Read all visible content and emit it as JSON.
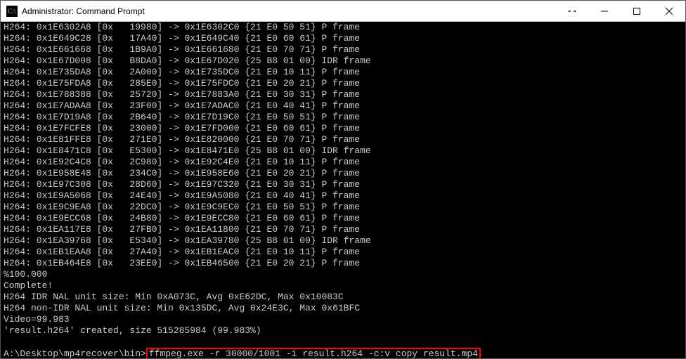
{
  "window": {
    "title": "Administrator: Command Prompt",
    "icon_name": "cmd-icon"
  },
  "rows": [
    {
      "tag": "H264:",
      "a": "0x1E6302A8",
      "b": "[0x",
      "c": "19980]",
      "d": "0x1E6302C0",
      "f": "{21 E0 50 51}",
      "t": "P frame"
    },
    {
      "tag": "H264:",
      "a": "0x1E649C28",
      "b": "[0x",
      "c": "17A40]",
      "d": "0x1E649C40",
      "f": "{21 E0 60 61}",
      "t": "P frame"
    },
    {
      "tag": "H264:",
      "a": "0x1E661668",
      "b": "[0x",
      "c": "1B9A0]",
      "d": "0x1E661680",
      "f": "{21 E0 70 71}",
      "t": "P frame"
    },
    {
      "tag": "H264:",
      "a": "0x1E67D008",
      "b": "[0x",
      "c": "B8DA0]",
      "d": "0x1E67D020",
      "f": "{25 B8 01 00}",
      "t": "IDR frame"
    },
    {
      "tag": "H264:",
      "a": "0x1E735DA8",
      "b": "[0x",
      "c": "2A000]",
      "d": "0x1E735DC0",
      "f": "{21 E0 10 11}",
      "t": "P frame"
    },
    {
      "tag": "H264:",
      "a": "0x1E75FDA8",
      "b": "[0x",
      "c": "285E0]",
      "d": "0x1E75FDC0",
      "f": "{21 E0 20 21}",
      "t": "P frame"
    },
    {
      "tag": "H264:",
      "a": "0x1E788388",
      "b": "[0x",
      "c": "25720]",
      "d": "0x1E7883A0",
      "f": "{21 E0 30 31}",
      "t": "P frame"
    },
    {
      "tag": "H264:",
      "a": "0x1E7ADAA8",
      "b": "[0x",
      "c": "23F00]",
      "d": "0x1E7ADAC0",
      "f": "{21 E0 40 41}",
      "t": "P frame"
    },
    {
      "tag": "H264:",
      "a": "0x1E7D19A8",
      "b": "[0x",
      "c": "2B640]",
      "d": "0x1E7D19C0",
      "f": "{21 E0 50 51}",
      "t": "P frame"
    },
    {
      "tag": "H264:",
      "a": "0x1E7FCFE8",
      "b": "[0x",
      "c": "23000]",
      "d": "0x1E7FD000",
      "f": "{21 E0 60 61}",
      "t": "P frame"
    },
    {
      "tag": "H264:",
      "a": "0x1E81FFE8",
      "b": "[0x",
      "c": "271E0]",
      "d": "0x1E820000",
      "f": "{21 E0 70 71}",
      "t": "P frame"
    },
    {
      "tag": "H264:",
      "a": "0x1E8471C8",
      "b": "[0x",
      "c": "E5300]",
      "d": "0x1E8471E0",
      "f": "{25 B8 01 00}",
      "t": "IDR frame"
    },
    {
      "tag": "H264:",
      "a": "0x1E92C4C8",
      "b": "[0x",
      "c": "2C980]",
      "d": "0x1E92C4E0",
      "f": "{21 E0 10 11}",
      "t": "P frame"
    },
    {
      "tag": "H264:",
      "a": "0x1E958E48",
      "b": "[0x",
      "c": "234C0]",
      "d": "0x1E958E60",
      "f": "{21 E0 20 21}",
      "t": "P frame"
    },
    {
      "tag": "H264:",
      "a": "0x1E97C308",
      "b": "[0x",
      "c": "28D60]",
      "d": "0x1E97C320",
      "f": "{21 E0 30 31}",
      "t": "P frame"
    },
    {
      "tag": "H264:",
      "a": "0x1E9A5068",
      "b": "[0x",
      "c": "24E40]",
      "d": "0x1E9A5080",
      "f": "{21 E0 40 41}",
      "t": "P frame"
    },
    {
      "tag": "H264:",
      "a": "0x1E9C9EA8",
      "b": "[0x",
      "c": "22DC0]",
      "d": "0x1E9C9EC0",
      "f": "{21 E0 50 51}",
      "t": "P frame"
    },
    {
      "tag": "H264:",
      "a": "0x1E9ECC68",
      "b": "[0x",
      "c": "24B80]",
      "d": "0x1E9ECC80",
      "f": "{21 E0 60 61}",
      "t": "P frame"
    },
    {
      "tag": "H264:",
      "a": "0x1EA117E8",
      "b": "[0x",
      "c": "27FB0]",
      "d": "0x1EA11800",
      "f": "{21 E0 70 71}",
      "t": "P frame"
    },
    {
      "tag": "H264:",
      "a": "0x1EA39768",
      "b": "[0x",
      "c": "E5340]",
      "d": "0x1EA39780",
      "f": "{25 B8 01 00}",
      "t": "IDR frame"
    },
    {
      "tag": "H264:",
      "a": "0x1EB1EAA8",
      "b": "[0x",
      "c": "27A40]",
      "d": "0x1EB1EAC0",
      "f": "{21 E0 10 11}",
      "t": "P frame"
    },
    {
      "tag": "H264:",
      "a": "0x1EB464E8",
      "b": "[0x",
      "c": "23EE0]",
      "d": "0x1EB46500",
      "f": "{21 E0 20 21}",
      "t": "P frame"
    }
  ],
  "post_lines": [
    "%100.000",
    "Complete!",
    "H264 IDR NAL unit size: Min 0xA073C, Avg 0xE62DC, Max 0x10083C",
    "H264 non-IDR NAL unit size: Min 0x135DC, Avg 0x24E3C, Max 0x61BFC",
    "Video=99.983",
    "'result.h264' created, size 515285984 (99.983%)",
    ""
  ],
  "prompt": {
    "path": "A:\\Desktop\\mp4recover\\bin>",
    "command": "ffmpeg.exe -r 30000/1001 -i result.h264 -c:v copy result.mp4"
  }
}
